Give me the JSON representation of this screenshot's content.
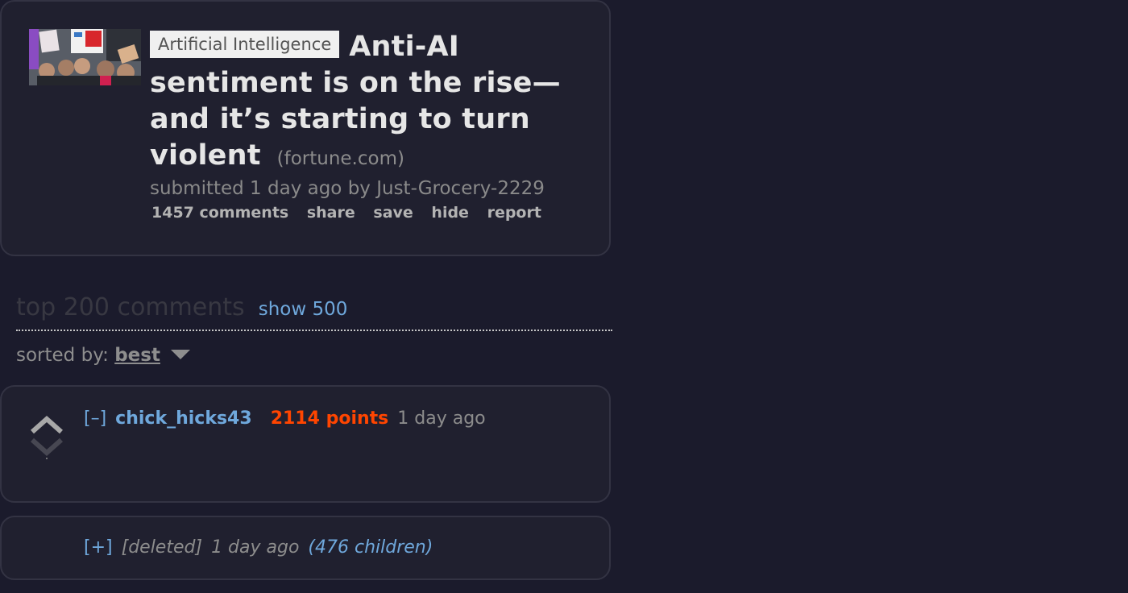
{
  "post": {
    "flair": "Artificial Intelligence",
    "title": "Anti-AI sentiment is on the rise—and it’s starting to turn violent",
    "domain": "(fortune.com)",
    "tagline": "submitted 1 day ago by Just-Grocery-2229",
    "thumbnail_icon": "protest-photo-thumbnail",
    "buttons": {
      "comments": "1457 comments",
      "share": "share",
      "save": "save",
      "hide": "hide",
      "report": "report"
    }
  },
  "comments_area": {
    "title": "top 200 comments",
    "show_more": "show 500",
    "sort_label": "sorted by:",
    "sort_value": "best"
  },
  "comments": [
    {
      "expand": "[–]",
      "author": "chick_hicks43",
      "score": "2114 points",
      "age": "1 day ago"
    },
    {
      "expand": "[+]",
      "author": "[deleted]",
      "age": "1 day ago",
      "children": "(476 children)"
    }
  ],
  "colors": {
    "background": "#1b1b2c",
    "card": "#20202f",
    "link": "#6fa8dc",
    "score": "#ff4500"
  }
}
